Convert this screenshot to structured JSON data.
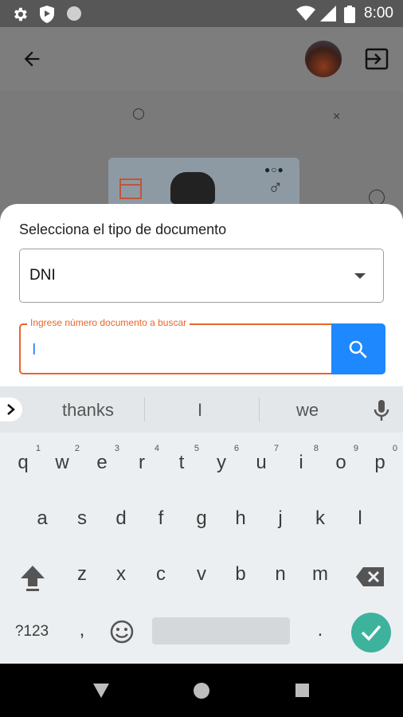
{
  "status_bar": {
    "time": "8:00"
  },
  "sheet": {
    "label": "Selecciona el tipo de documento",
    "document_type_value": "DNI",
    "search_label": "Ingrese número documento a buscar",
    "search_value": "I"
  },
  "keyboard": {
    "suggestions": [
      "thanks",
      "I",
      "we"
    ],
    "row1": [
      {
        "k": "q",
        "n": "1"
      },
      {
        "k": "w",
        "n": "2"
      },
      {
        "k": "e",
        "n": "3"
      },
      {
        "k": "r",
        "n": "4"
      },
      {
        "k": "t",
        "n": "5"
      },
      {
        "k": "y",
        "n": "6"
      },
      {
        "k": "u",
        "n": "7"
      },
      {
        "k": "i",
        "n": "8"
      },
      {
        "k": "o",
        "n": "9"
      },
      {
        "k": "p",
        "n": "0"
      }
    ],
    "row2": [
      "a",
      "s",
      "d",
      "f",
      "g",
      "h",
      "j",
      "k",
      "l"
    ],
    "row3": [
      "z",
      "x",
      "c",
      "v",
      "b",
      "n",
      "m"
    ],
    "symbols_label": "?123",
    "comma": ",",
    "period": "."
  },
  "colors": {
    "accent": "#e8652a",
    "search_button": "#1e88ff",
    "done": "#3db39e"
  }
}
